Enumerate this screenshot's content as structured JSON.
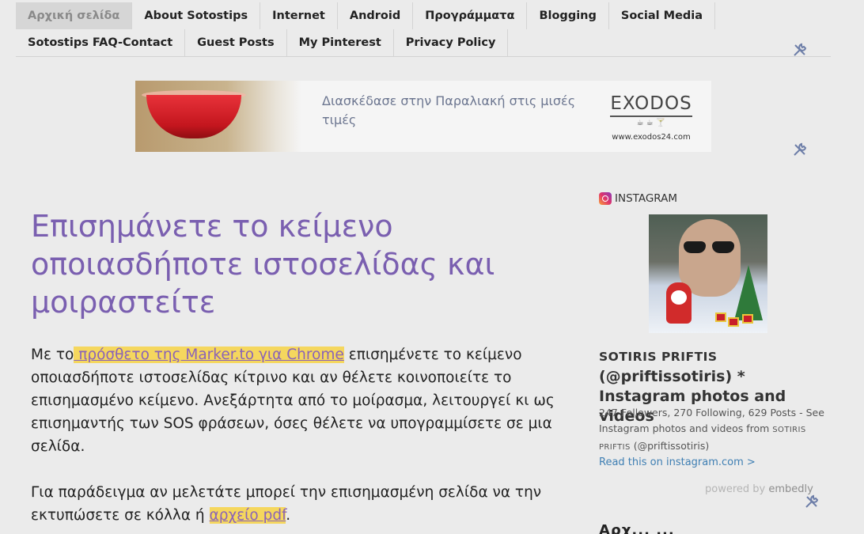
{
  "nav": {
    "row1": [
      "Αρχική σελίδα",
      "About Sotostips",
      "Internet",
      "Android",
      "Προγράμματα",
      "Blogging",
      "Social Media"
    ],
    "row2": [
      "Sotostips FAQ-Contact",
      "Guest Posts",
      "My Pinterest",
      "Privacy Policy"
    ],
    "active_index": 0
  },
  "ad": {
    "text": "Διασκέδασε στην Παραλιακή στις μισές τιμές",
    "logo_name": "EXODOS",
    "logo_url": "www.exodos24.com"
  },
  "article": {
    "title": "Επισημάνετε το κείμενο οποιασδήποτε ιστοσελίδας και μοιραστείτε",
    "p1_before": "Με το",
    "p1_link": " πρόσθετο της Marker.to για Chrome",
    "p1_after": " επισημένετε το κείμενο οποιασδήποτε ιστοσελίδας κίτρινο και αν θέλετε κοινοποιείτε το επισημασμένο κείμενο. Ανεξάρτητα από το μοίρασμα, λειτουργεί κι ως επισημαντής των SOS φράσεων, όσες θέλετε να υπογραμμίσετε σε μια σελίδα.",
    "p2_before": "Για παράδειγμα αν μελετάτε μπορεί την επισημασμένη σελίδα να την εκτυπώσετε σε κόλλα ή ",
    "p2_link": "αρχείο pdf",
    "p2_after": "."
  },
  "sidebar": {
    "heading": "INSTAGRAM",
    "name_caps": "SOTIRIS PRIFTIS",
    "name_rest": "(@priftissotiris) * Instagram photos and videos",
    "desc_before": "247 Followers, 270 Following, 629 Posts - See Instagram photos and videos from ",
    "desc_caps": "SOTIRIS PRIFTIS",
    "desc_after": " (@priftissotiris)",
    "read_link": "Read this on instagram.com >",
    "powered_prefix": "powered by ",
    "powered_brand": "embedly",
    "next_heading": "Αρχ... ..."
  },
  "icons": {
    "tool": "edit-tools-icon",
    "instagram": "instagram-icon"
  },
  "colors": {
    "title": "#7a5fb0",
    "highlight": "#f5d75e",
    "link": "#3f7fb3"
  }
}
